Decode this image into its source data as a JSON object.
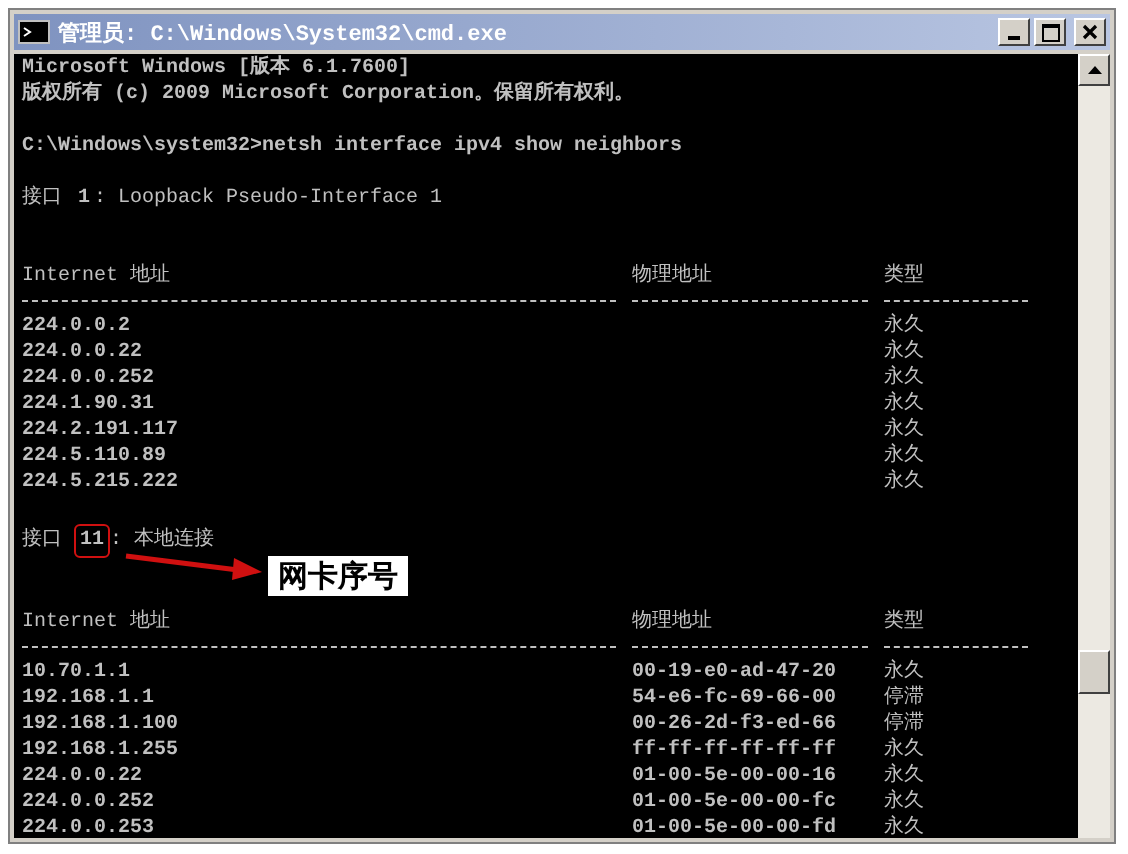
{
  "window": {
    "title": "管理员: C:\\Windows\\System32\\cmd.exe"
  },
  "console": {
    "header_lines": [
      "Microsoft Windows [版本 6.1.7600]",
      "版权所有 (c) 2009 Microsoft Corporation。保留所有权利。"
    ],
    "command": "C:\\Windows\\system32>netsh interface ipv4 show neighbors",
    "sections": [
      {
        "interface": {
          "label": "接口",
          "index": "1",
          "rest": ": Loopback Pseudo-Interface 1",
          "highlighted": false
        },
        "columns": [
          "Internet 地址",
          "物理地址",
          "类型"
        ],
        "rows": [
          {
            "internet_address": "224.0.0.2",
            "type": "永久"
          },
          {
            "internet_address": "224.0.0.22",
            "type": "永久"
          },
          {
            "internet_address": "224.0.0.252",
            "type": "永久"
          },
          {
            "internet_address": "224.1.90.31",
            "type": "永久"
          },
          {
            "internet_address": "224.2.191.117",
            "type": "永久"
          },
          {
            "internet_address": "224.5.110.89",
            "type": "永久"
          },
          {
            "internet_address": "224.5.215.222",
            "type": "永久"
          }
        ]
      },
      {
        "interface": {
          "label": "接口",
          "index": "11",
          "rest": ": 本地连接",
          "highlighted": true
        },
        "callout": "网卡序号",
        "columns": [
          "Internet 地址",
          "物理地址",
          "类型"
        ],
        "rows": [
          {
            "internet_address": "10.70.1.1",
            "physical_address": "00-19-e0-ad-47-20",
            "type": "永久"
          },
          {
            "internet_address": "192.168.1.1",
            "physical_address": "54-e6-fc-69-66-00",
            "type": "停滞"
          },
          {
            "internet_address": "192.168.1.100",
            "physical_address": "00-26-2d-f3-ed-66",
            "type": "停滞"
          },
          {
            "internet_address": "192.168.1.255",
            "physical_address": "ff-ff-ff-ff-ff-ff",
            "type": "永久"
          },
          {
            "internet_address": "224.0.0.22",
            "physical_address": "01-00-5e-00-00-16",
            "type": "永久"
          },
          {
            "internet_address": "224.0.0.252",
            "physical_address": "01-00-5e-00-00-fc",
            "type": "永久"
          },
          {
            "internet_address": "224.0.0.253",
            "physical_address": "01-00-5e-00-00-fd",
            "type": "永久"
          }
        ]
      }
    ]
  }
}
